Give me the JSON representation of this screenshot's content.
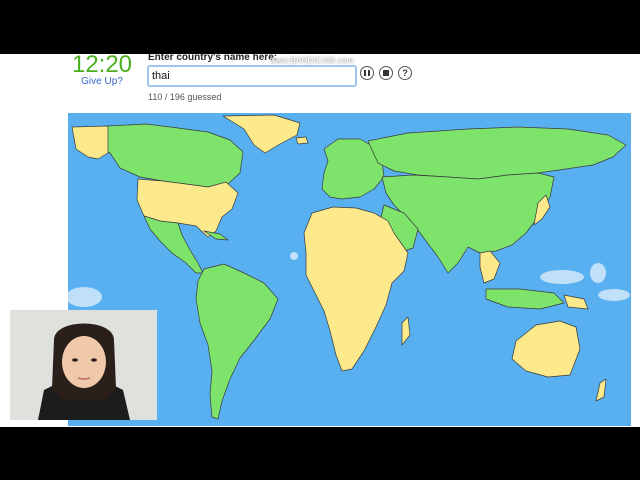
{
  "timer": "12:20",
  "give_up_label": "Give Up?",
  "prompt_label": "Enter country's name here:",
  "answer_value": "thai",
  "progress_text": "110 / 196 guessed",
  "recorder_watermark": "www.BANDICAM.com",
  "controls": {
    "pause_icon": "pause-icon",
    "stop_icon": "stop-icon",
    "help_glyph": "?"
  },
  "map_colors": {
    "ocean": "#58b0f0",
    "guessed": "#7de36b",
    "unguessed": "#fbe98c",
    "border": "#3a3a3a"
  }
}
